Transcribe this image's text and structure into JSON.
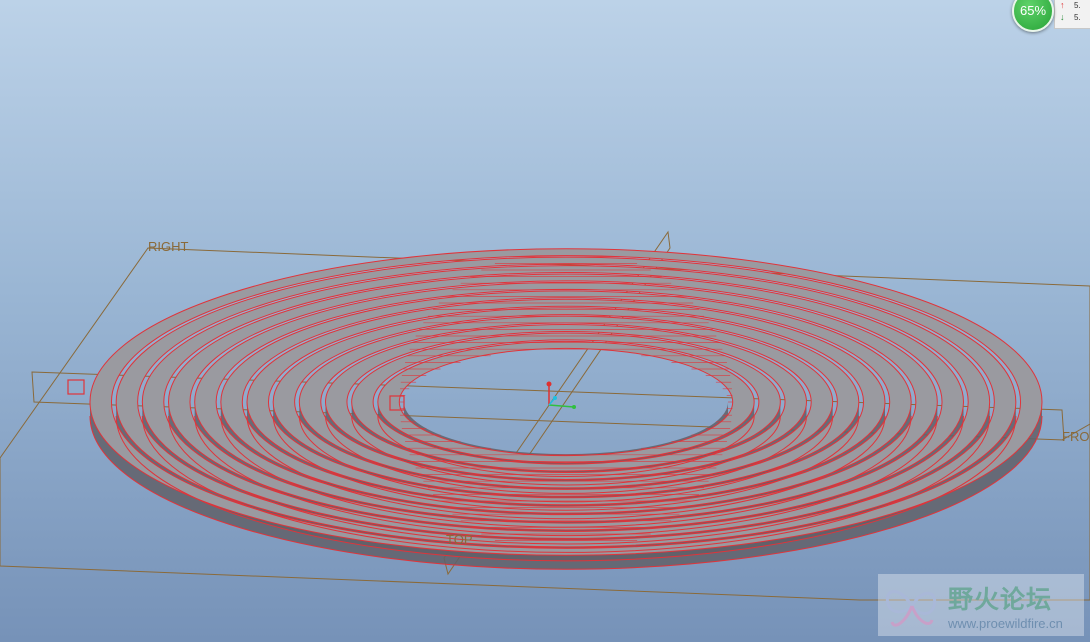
{
  "viewport": {
    "planes": {
      "right": "RIGHT",
      "front": "FRO",
      "top": "TOP"
    },
    "colors": {
      "edge": "#e0343a",
      "face": "#9a9aa0",
      "side": "#606068",
      "datum": "#8a6a3a"
    }
  },
  "meter": {
    "percent": "65%",
    "up_rate": "5.",
    "down_rate": "5.",
    "up_icon": "arrow-up-icon",
    "down_icon": "arrow-down-icon"
  },
  "watermark": {
    "text": "野火论坛",
    "url": "www.proewildfire.cn",
    "logo_icon": "butterfly-logo-icon"
  }
}
